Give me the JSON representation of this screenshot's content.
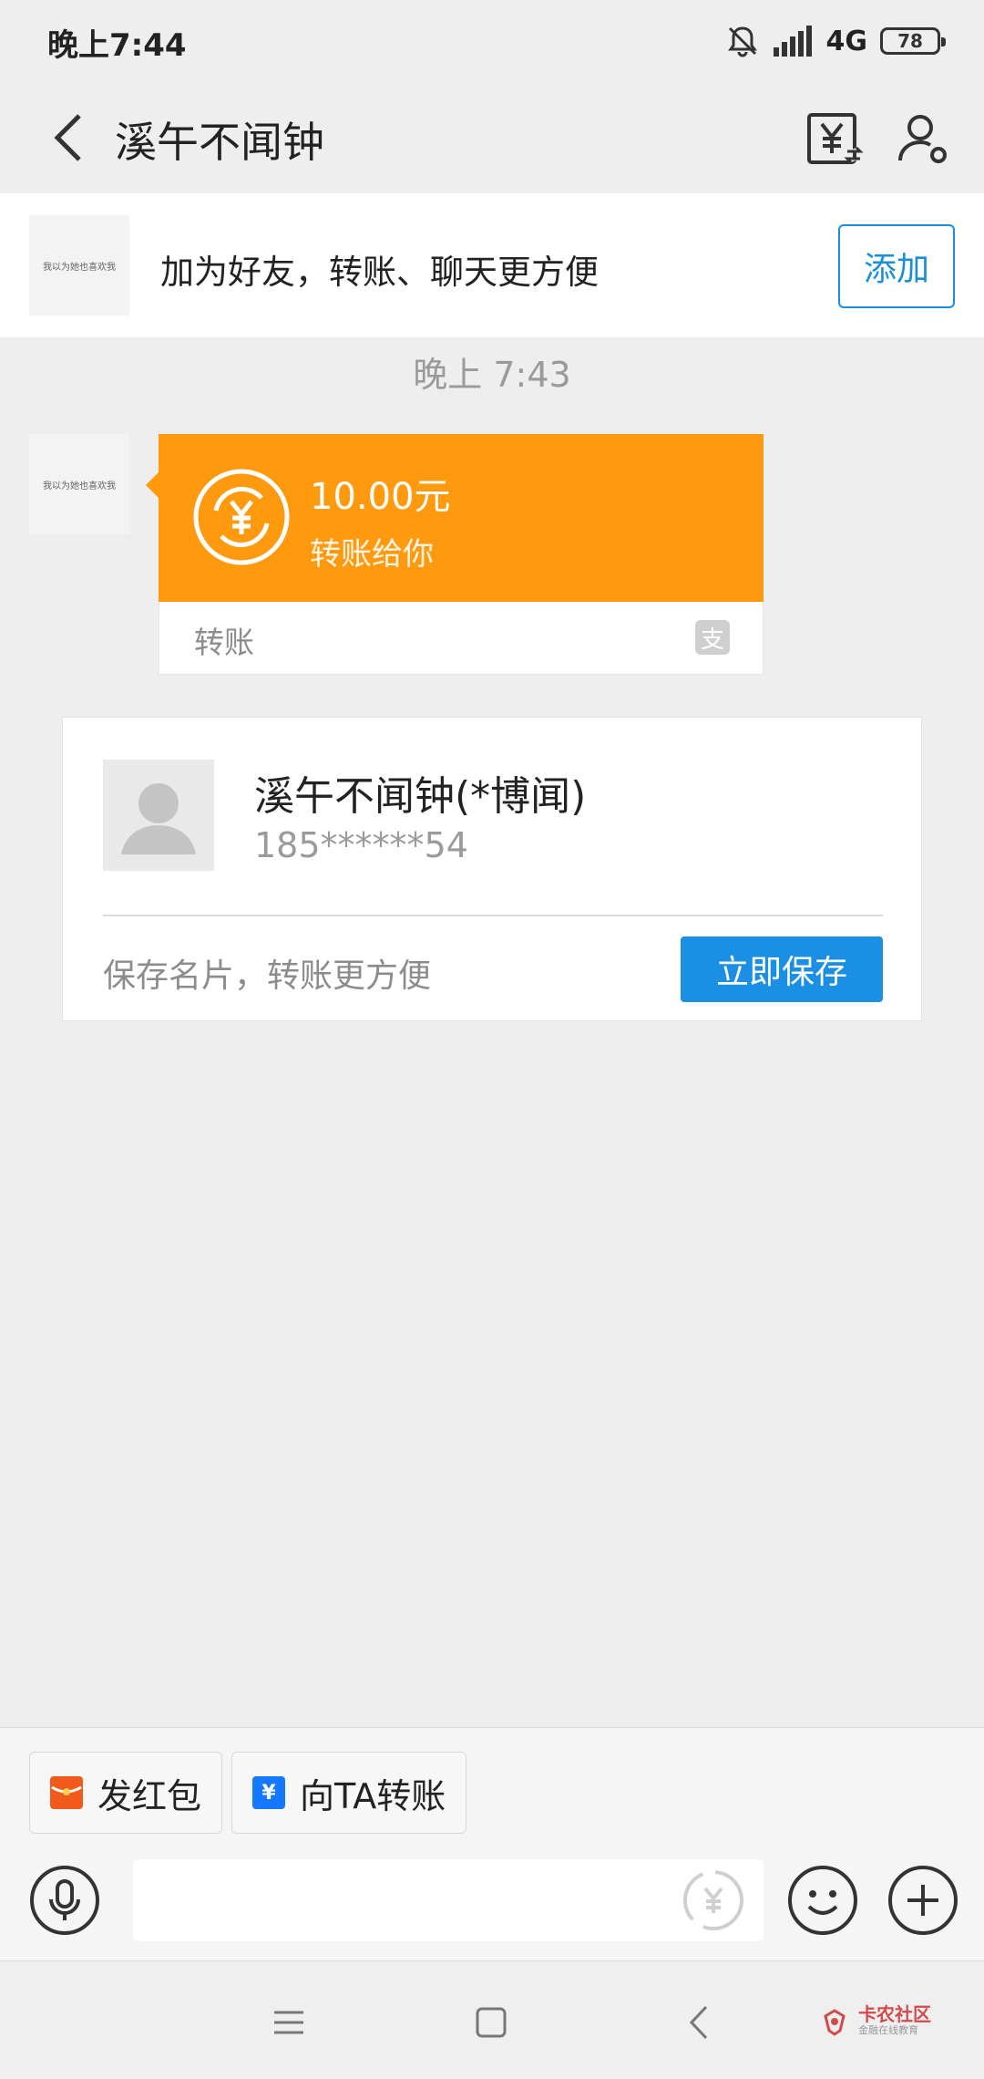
{
  "status_bar": {
    "time": "晚上7:44",
    "network": "4G",
    "battery": "78"
  },
  "header": {
    "title": "溪午不闻钟"
  },
  "friend_banner": {
    "avatar_text": "我以为她也喜欢我",
    "text": "加为好友，转账、聊天更方便",
    "add_label": "添加"
  },
  "chat": {
    "timestamp": "晚上 7:43",
    "avatar_text": "我以为她也喜欢我",
    "transfer": {
      "amount": "10.00元",
      "desc": "转账给你",
      "type": "转账"
    }
  },
  "contact_card": {
    "name": "溪午不闻钟(*博闻)",
    "phone": "185******54",
    "hint": "保存名片，转账更方便",
    "save_label": "立即保存"
  },
  "quick_actions": [
    {
      "label": "发红包",
      "icon": "red-packet-icon",
      "color": "#f25a1c"
    },
    {
      "label": "向TA转账",
      "icon": "transfer-icon",
      "color": "#1677ff"
    }
  ],
  "watermark": {
    "title": "卡农社区",
    "subtitle": "金融在线教育"
  },
  "colors": {
    "orange": "#ff9a0f",
    "blue": "#1a8fe3",
    "background": "#eeeeee"
  }
}
